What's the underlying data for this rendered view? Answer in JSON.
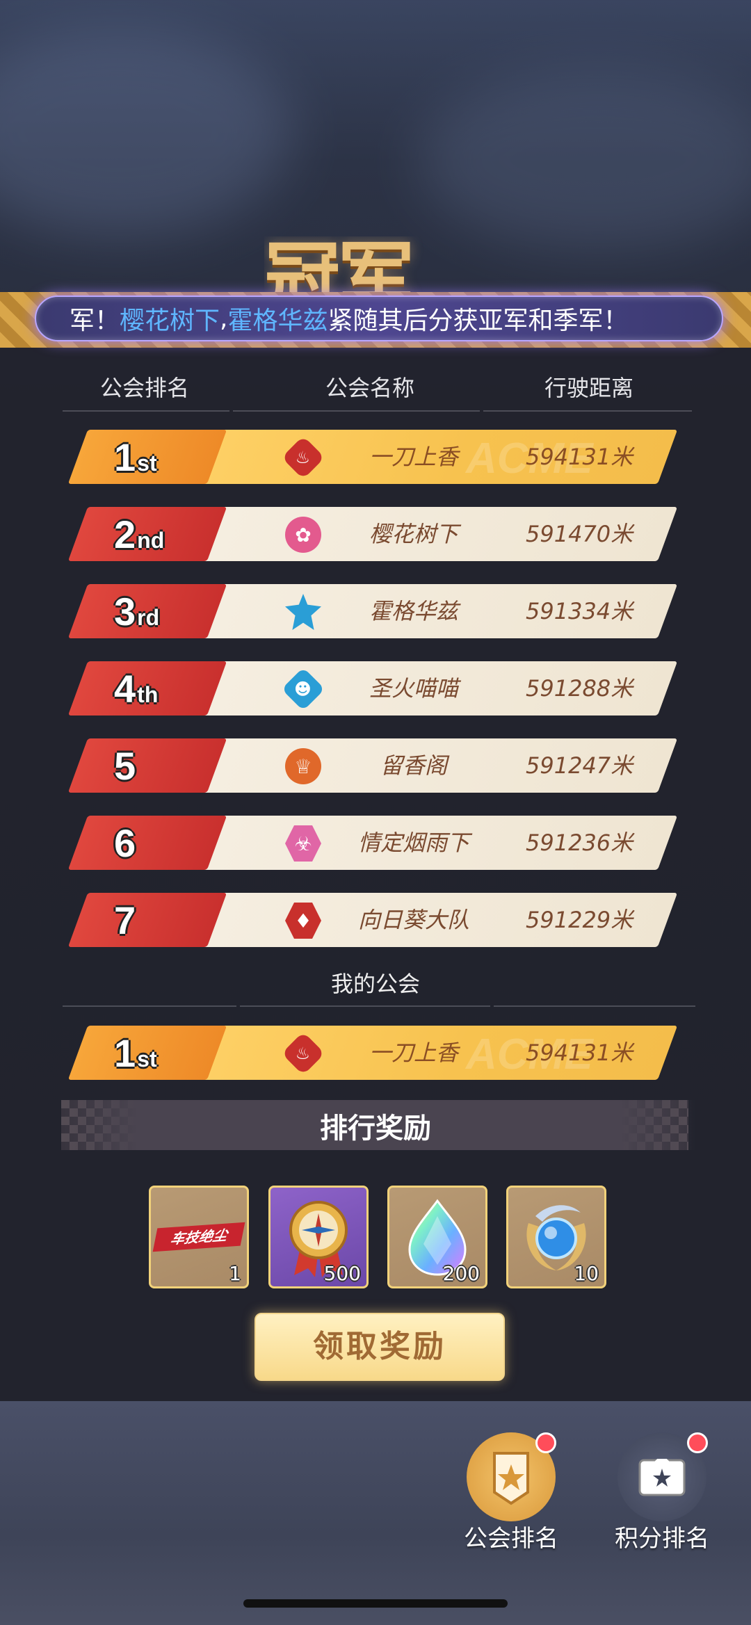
{
  "header": {
    "title_art": "冠军",
    "ticker": {
      "prefix": "军！",
      "silver": "樱花树下",
      "comma": ",",
      "bronze": "霍格华兹",
      "suffix": "紧随其后分获亚军和季军！"
    }
  },
  "table": {
    "columns": [
      "公会排名",
      "公会名称",
      "行驶距离"
    ],
    "rows": [
      {
        "rank": "1",
        "suffix": "st",
        "name": "一刀上香",
        "distance": "594131米",
        "emblem": "flame-icon"
      },
      {
        "rank": "2",
        "suffix": "nd",
        "name": "樱花树下",
        "distance": "591470米",
        "emblem": "rose-icon"
      },
      {
        "rank": "3",
        "suffix": "rd",
        "name": "霍格华兹",
        "distance": "591334米",
        "emblem": "crown-icon"
      },
      {
        "rank": "4",
        "suffix": "th",
        "name": "圣火喵喵",
        "distance": "591288米",
        "emblem": "cat-icon"
      },
      {
        "rank": "5",
        "suffix": "",
        "name": "留香阁",
        "distance": "591247米",
        "emblem": "crown-icon"
      },
      {
        "rank": "6",
        "suffix": "",
        "name": "情定烟雨下",
        "distance": "591236米",
        "emblem": "trident-icon"
      },
      {
        "rank": "7",
        "suffix": "",
        "name": "向日葵大队",
        "distance": "591229米",
        "emblem": "gem-icon"
      }
    ]
  },
  "my_guild": {
    "label": "我的公会",
    "row": {
      "rank": "1",
      "suffix": "st",
      "name": "一刀上香",
      "distance": "594131米",
      "emblem": "flame-icon"
    }
  },
  "rewards": {
    "title": "排行奖励",
    "items": [
      {
        "label": "车技绝尘",
        "qty": "1"
      },
      {
        "qty": "500"
      },
      {
        "qty": "200"
      },
      {
        "qty": "10"
      }
    ],
    "claim_label": "领取奖励"
  },
  "nav": {
    "guild_rank": "公会排名",
    "points_rank": "积分排名"
  }
}
